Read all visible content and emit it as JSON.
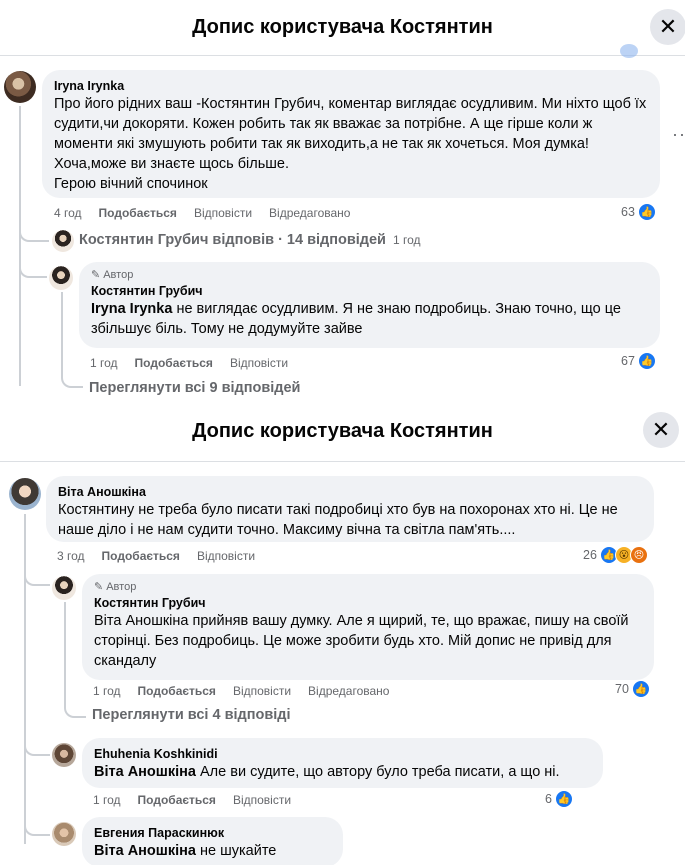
{
  "top": {
    "title": "Допис користувача Костянтин",
    "comment": {
      "author": "Iryna Irynka",
      "text": "Про його рідних ваш -Костянтин Грубич, коментар виглядає осудливим. Ми ніхто щоб їх судити,чи докоряти. Кожен робить так як вважає за потрібне. А ще гірше коли ж моменти які змушують робити так як виходить,а не так як хочеться. Моя думка! Хоча,може ви знаєте щось більше.",
      "text_last": "Герою вічний спочинок",
      "time": "4 год",
      "like": "Подобається",
      "reply": "Відповісти",
      "edited": "Відредаговано",
      "reactions": "63"
    },
    "replies_summary": {
      "name": "Костянтин Грубич відповів",
      "count": " · 14 відповідей",
      "time": "1 год"
    },
    "reply": {
      "badge": "Автор",
      "author": "Костянтин Грубич",
      "mention": "Iryna Irynka",
      "text": " не виглядає осудливим. Я не знаю подробиць. Знаю точно, що це збільшує біль. Тому не додумуйте зайве",
      "time": "1 год",
      "like": "Подобається",
      "reply": "Відповісти",
      "reactions": "67"
    },
    "view_all": "Переглянути всі 9 відповідей"
  },
  "bottom": {
    "title": "Допис користувача Костянтин",
    "comment": {
      "author": "Віта Аношкіна",
      "text": "Костянтину не треба було писати такі подробиці хто був на похоронах хто ні. Це не наше діло і не нам судити точно. Максиму вічна та світла пам'ять....",
      "time": "3 год",
      "like": "Подобається",
      "reply": "Відповісти",
      "reactions": "26"
    },
    "reply": {
      "badge": "Автор",
      "author": "Костянтин Грубич",
      "mention": "Віта Аношкіна",
      "text": " прийняв вашу думку. Але я щирий, те, що вражає, пишу на своїй сторінці. Без подробиць. Це може зробити будь хто. Мій допис не привід для скандалу",
      "time": "1 год",
      "like": "Подобається",
      "reply": "Відповісти",
      "edited": "Відредаговано",
      "reactions": "70"
    },
    "view_all": "Переглянути всі 4 відповіді",
    "comment2": {
      "author": "Ehuhenia Koshkinidi",
      "mention": "Віта Аношкіна",
      "text": " Але ви судите, що автору було треба писати, а що ні.",
      "time": "1 год",
      "like": "Подобається",
      "reply": "Відповісти",
      "reactions": "6"
    },
    "comment3": {
      "author": "Евгения Параскинюк",
      "mention": "Віта Аношкіна",
      "text": " не шукайте винних!"
    }
  },
  "icons": {
    "close": "close-icon",
    "like": "like-icon",
    "wow": "wow-icon",
    "angry": "angry-icon",
    "pen": "pen-icon"
  },
  "colors": {
    "accent": "#1877f2",
    "bubble": "#f0f2f5",
    "muted": "#65676b"
  }
}
